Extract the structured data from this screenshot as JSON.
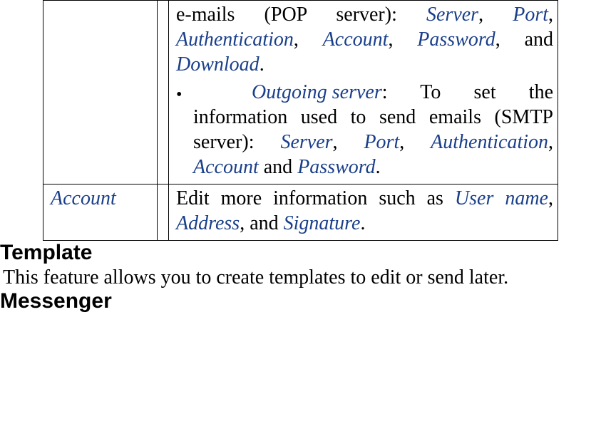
{
  "table": {
    "row_server": {
      "incoming_tail_pre": "e-mails (POP server): ",
      "incoming_terms": [
        "Server",
        "Port",
        "Authentication",
        "Account",
        "Password",
        "Download"
      ],
      "bullet": "•",
      "outgoing_label": "Outgoing server",
      "outgoing_after_colon": ": To set the information used to send emails (SMTP server): ",
      "outgoing_terms": [
        "Server",
        "Port",
        "Authentication",
        "Account",
        "Password"
      ]
    },
    "row_account": {
      "label": "Account",
      "content_pre": "Edit more information such as ",
      "terms": [
        "User name",
        "Address",
        "Signature"
      ]
    }
  },
  "sections": {
    "template": {
      "heading": "Template",
      "body": "This feature allows you to create templates to edit or send later."
    },
    "messenger": {
      "heading": "Messenger"
    }
  }
}
